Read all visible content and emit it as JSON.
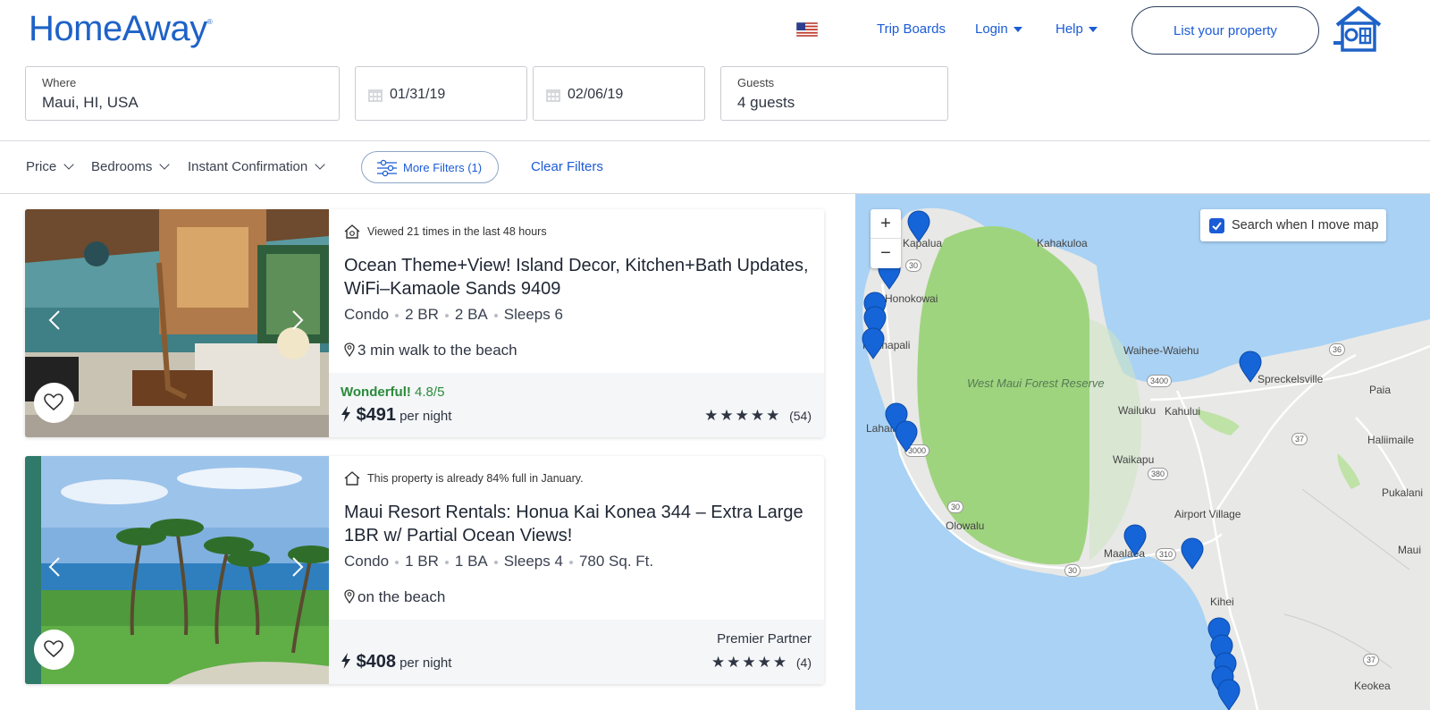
{
  "header": {
    "logo": "HomeAway",
    "logo_mark": "®",
    "nav": {
      "trip_boards": "Trip Boards",
      "login": "Login",
      "help": "Help",
      "list_property": "List your property"
    }
  },
  "search": {
    "where_label": "Where",
    "where_value": "Maui, HI, USA",
    "checkin": "01/31/19",
    "checkout": "02/06/19",
    "guests_label": "Guests",
    "guests_value": "4 guests"
  },
  "filters": {
    "price": "Price",
    "bedrooms": "Bedrooms",
    "instant": "Instant Confirmation",
    "more": "More Filters (1)",
    "clear": "Clear Filters"
  },
  "listings": [
    {
      "notice": "Viewed 21 times in the last 48 hours",
      "title": "Ocean Theme+View! Island Decor, Kitchen+Bath Updates, WiFi–Kamaole Sands 9409",
      "type": "Condo",
      "br": "2 BR",
      "ba": "2 BA",
      "sleeps": "Sleeps 6",
      "location": "3 min walk to the beach",
      "rating_word": "Wonderful!",
      "rating_score": "4.8/5",
      "price": "$491",
      "per": "per night",
      "stars": "★★★★★",
      "reviews": "(54)"
    },
    {
      "notice": "This property is already 84% full in January.",
      "title": "Maui Resort Rentals: Honua Kai Konea 344 – Extra Large 1BR w/ Partial Ocean Views!",
      "type": "Condo",
      "br": "1 BR",
      "ba": "1 BA",
      "sleeps": "Sleeps 4",
      "sqft": "780 Sq. Ft.",
      "location": "on the beach",
      "partner": "Premier Partner",
      "price": "$408",
      "per": "per night",
      "stars": "★★★★★",
      "reviews": "(4)"
    }
  ],
  "map": {
    "zoom_in": "+",
    "zoom_out": "−",
    "search_move": "Search when I move map",
    "labels": {
      "kahakuloa": "Kahakuloa",
      "kapalua": "Kapalua",
      "honokowai": "Honokowai",
      "kaanapali": "Kaanapali",
      "lahaina": "Lahaina",
      "forest": "West Maui Forest Reserve",
      "waihee": "Waihee-Waiehu",
      "wailuku": "Wailuku",
      "kahului": "Kahului",
      "spreckelsville": "Spreckelsville",
      "paia": "Paia",
      "haliimaile": "Haliimaile",
      "waikapu": "Waikapu",
      "pukalani": "Pukalani",
      "airport": "Airport Village",
      "olowalu": "Olowalu",
      "maalaea": "Maalaea",
      "maui": "Maui",
      "kihei": "Kihei",
      "keokea": "Keokea"
    },
    "routes": {
      "r30a": "30",
      "r30b": "30",
      "r30c": "30",
      "r36": "36",
      "r3400": "3400",
      "r37a": "37",
      "r37b": "37",
      "r380": "380",
      "r310": "310",
      "r3000": "3000"
    }
  },
  "colors": {
    "brand": "#1e62c7",
    "link": "#1b5bd6",
    "rating_green": "#2a8a3a",
    "pin": "#1565d8"
  }
}
